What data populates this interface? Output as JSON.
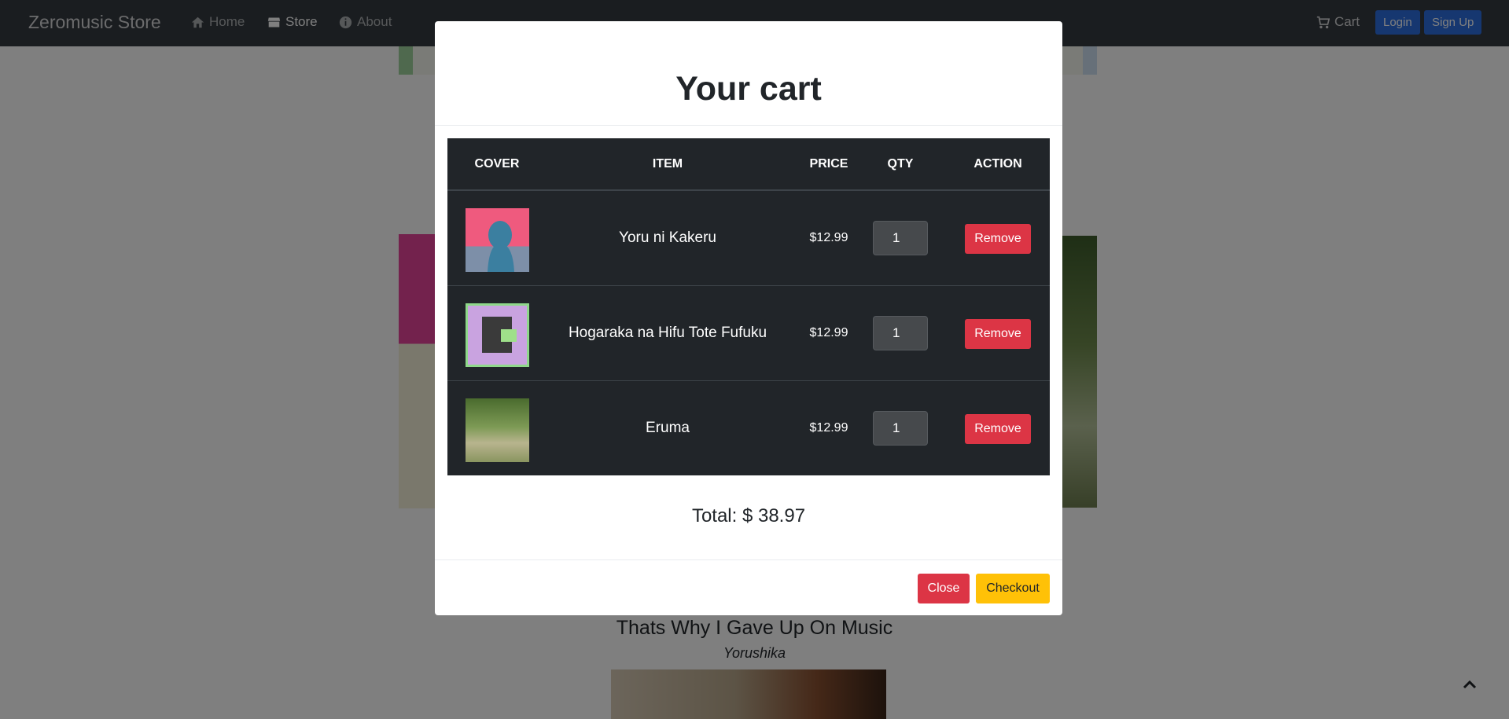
{
  "navbar": {
    "brand": "Zeromusic Store",
    "links": [
      {
        "label": "Home",
        "icon": "home-icon"
      },
      {
        "label": "Store",
        "icon": "store-icon"
      },
      {
        "label": "About",
        "icon": "info-icon"
      }
    ],
    "cart_label": "Cart",
    "login_label": "Login",
    "signup_label": "Sign Up"
  },
  "background": {
    "album_title": "Thats Why I Gave Up On Music",
    "album_artist": "Yorushika"
  },
  "modal": {
    "title": "Your cart",
    "columns": [
      "COVER",
      "ITEM",
      "PRICE",
      "QTY",
      "ACTION"
    ],
    "items": [
      {
        "name": "Yoru ni Kakeru",
        "price": "$12.99",
        "qty": "1",
        "action": "Remove"
      },
      {
        "name": "Hogaraka na Hifu Tote Fufuku",
        "price": "$12.99",
        "qty": "1",
        "action": "Remove"
      },
      {
        "name": "Eruma",
        "price": "$12.99",
        "qty": "1",
        "action": "Remove"
      }
    ],
    "total": "Total: $ 38.97",
    "close_label": "Close",
    "checkout_label": "Checkout"
  },
  "colors": {
    "navbar_bg": "#343a40",
    "table_bg": "#212529",
    "danger": "#dc3545",
    "warning": "#ffc107",
    "primary": "#2d6fe0"
  }
}
